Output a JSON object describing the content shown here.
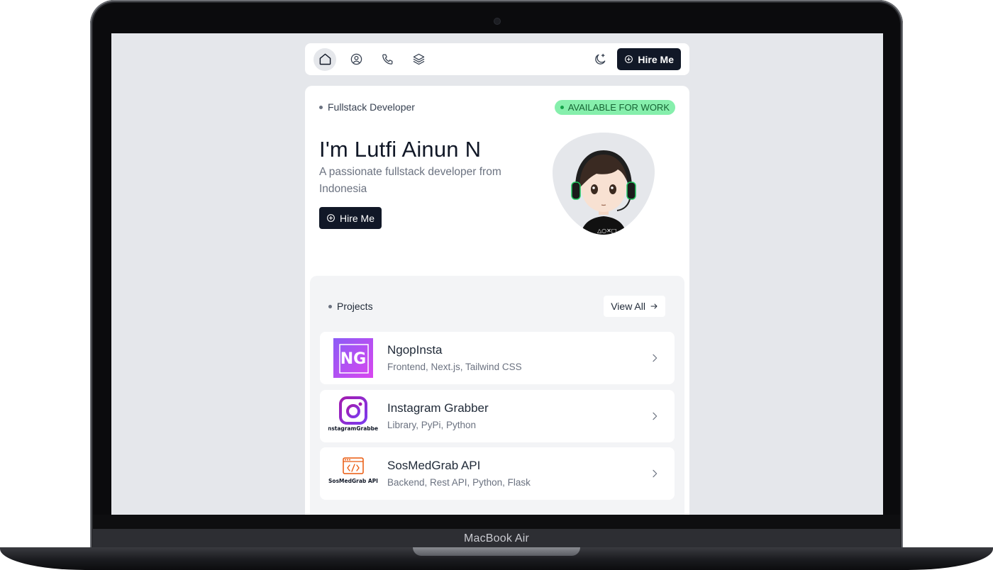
{
  "device": {
    "brand_label": "MacBook Air"
  },
  "navbar": {
    "items": [
      {
        "icon": "home-icon",
        "active": true
      },
      {
        "icon": "user-icon",
        "active": false
      },
      {
        "icon": "phone-icon",
        "active": false
      },
      {
        "icon": "layers-icon",
        "active": false
      }
    ],
    "theme_icon": "moon-icon",
    "hire_label": "Hire Me"
  },
  "hero": {
    "role": "Fullstack Developer",
    "badge": "AVAILABLE FOR WORK",
    "name": "I'm Lutfi Ainun N",
    "description": "A passionate fullstack developer from Indonesia",
    "hire_label": "Hire Me"
  },
  "projects": {
    "title": "Projects",
    "view_all_label": "View All",
    "items": [
      {
        "name": "NgopInsta",
        "tags": "Frontend, Next.js, Tailwind CSS",
        "logo_text": "NG"
      },
      {
        "name": "Instagram Grabber",
        "tags": "Library, PyPi, Python",
        "logo_text": "InstagramGrabber"
      },
      {
        "name": "SosMedGrab API",
        "tags": "Backend, Rest API, Python, Flask",
        "logo_text": "SosMedGrab API"
      }
    ]
  },
  "colors": {
    "accent_dark": "#111827",
    "badge_green": "#86efac",
    "badge_text": "#166534",
    "page_bg": "#e5e7eb"
  }
}
